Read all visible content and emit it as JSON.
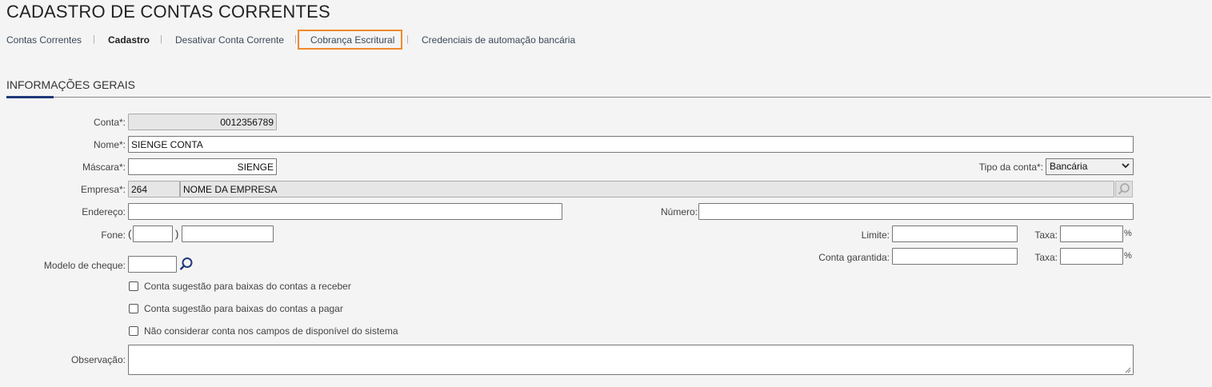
{
  "page": {
    "title": "CADASTRO DE CONTAS CORRENTES"
  },
  "tabs": [
    {
      "label": "Contas Correntes"
    },
    {
      "label": "Cadastro"
    },
    {
      "label": "Desativar Conta Corrente"
    },
    {
      "label": "Cobrança Escritural"
    },
    {
      "label": "Credenciais de automação bancária"
    }
  ],
  "tab_separator": "|",
  "section": {
    "title": "INFORMAÇÕES GERAIS"
  },
  "form": {
    "conta": {
      "label": "Conta*:",
      "value": "0012356789"
    },
    "nome": {
      "label": "Nome*:",
      "value": "SIENGE CONTA"
    },
    "mascara": {
      "label": "Máscara*:",
      "value": "SIENGE"
    },
    "tipo_conta": {
      "label": "Tipo da conta*:",
      "value": "Bancária"
    },
    "empresa": {
      "label": "Empresa*:",
      "code": "264",
      "name": "NOME DA EMPRESA"
    },
    "endereco": {
      "label": "Endereço:",
      "value": ""
    },
    "numero": {
      "label": "Número:",
      "value": ""
    },
    "fone": {
      "label": "Fone:",
      "open_paren": "(",
      "close_paren": ")",
      "ddd": "",
      "number": ""
    },
    "limite": {
      "label": "Limite:",
      "value": ""
    },
    "taxa1": {
      "label": "Taxa:",
      "value": "",
      "unit": "%"
    },
    "modelo_cheque": {
      "label": "Modelo de cheque:",
      "value": ""
    },
    "conta_garantida": {
      "label": "Conta garantida:",
      "value": ""
    },
    "taxa2": {
      "label": "Taxa:",
      "value": "",
      "unit": "%"
    },
    "checkboxes": [
      {
        "label": "Conta sugestão para baixas do contas a receber",
        "checked": false
      },
      {
        "label": "Conta sugestão para baixas do contas a pagar",
        "checked": false
      },
      {
        "label": "Não considerar conta nos campos de disponível do sistema",
        "checked": false
      }
    ],
    "observacao": {
      "label": "Observação:",
      "value": ""
    }
  },
  "colors": {
    "accent": "#1f3a7a",
    "highlight": "#ef8a2b"
  }
}
